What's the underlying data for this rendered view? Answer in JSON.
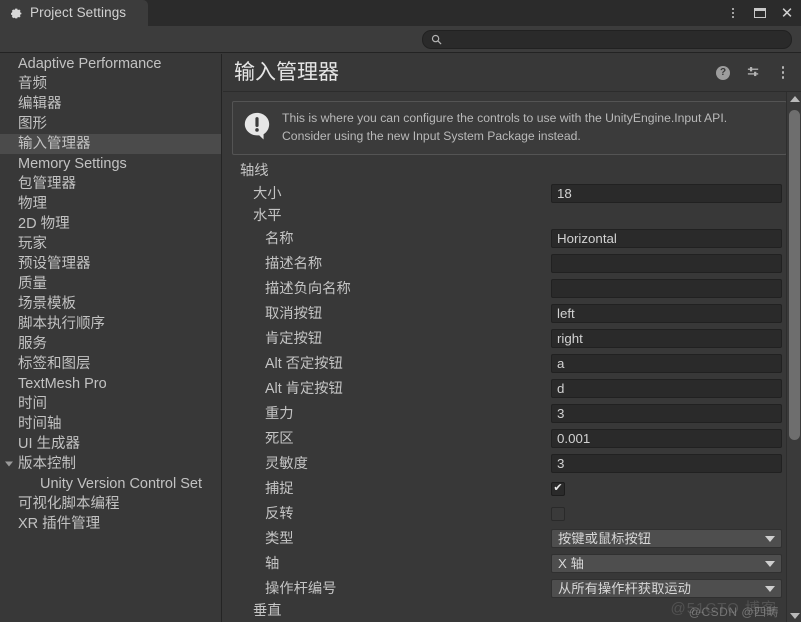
{
  "window": {
    "tab_label": "Project Settings",
    "tab_icon": "gear-icon",
    "controls": {
      "menu": "⋮",
      "maximize": "maximize-icon",
      "close": "✕"
    }
  },
  "search": {
    "value": "",
    "placeholder": "",
    "icon": "search-icon"
  },
  "sidebar": {
    "items": [
      {
        "label": "Adaptive Performance",
        "indent": 0,
        "selected": false,
        "arrow": ""
      },
      {
        "label": "音频",
        "indent": 0,
        "selected": false,
        "arrow": ""
      },
      {
        "label": "编辑器",
        "indent": 0,
        "selected": false,
        "arrow": ""
      },
      {
        "label": "图形",
        "indent": 0,
        "selected": false,
        "arrow": ""
      },
      {
        "label": "输入管理器",
        "indent": 0,
        "selected": true,
        "arrow": ""
      },
      {
        "label": "Memory Settings",
        "indent": 0,
        "selected": false,
        "arrow": ""
      },
      {
        "label": "包管理器",
        "indent": 0,
        "selected": false,
        "arrow": ""
      },
      {
        "label": "物理",
        "indent": 0,
        "selected": false,
        "arrow": ""
      },
      {
        "label": "2D 物理",
        "indent": 0,
        "selected": false,
        "arrow": ""
      },
      {
        "label": "玩家",
        "indent": 0,
        "selected": false,
        "arrow": ""
      },
      {
        "label": "预设管理器",
        "indent": 0,
        "selected": false,
        "arrow": ""
      },
      {
        "label": "质量",
        "indent": 0,
        "selected": false,
        "arrow": ""
      },
      {
        "label": "场景模板",
        "indent": 0,
        "selected": false,
        "arrow": ""
      },
      {
        "label": "脚本执行顺序",
        "indent": 0,
        "selected": false,
        "arrow": ""
      },
      {
        "label": "服务",
        "indent": 0,
        "selected": false,
        "arrow": ""
      },
      {
        "label": "标签和图层",
        "indent": 0,
        "selected": false,
        "arrow": ""
      },
      {
        "label": "TextMesh Pro",
        "indent": 0,
        "selected": false,
        "arrow": ""
      },
      {
        "label": "时间",
        "indent": 0,
        "selected": false,
        "arrow": ""
      },
      {
        "label": "时间轴",
        "indent": 0,
        "selected": false,
        "arrow": ""
      },
      {
        "label": "UI 生成器",
        "indent": 0,
        "selected": false,
        "arrow": ""
      },
      {
        "label": "版本控制",
        "indent": 0,
        "selected": false,
        "arrow": "open"
      },
      {
        "label": "Unity Version Control Set",
        "indent": 1,
        "selected": false,
        "arrow": ""
      },
      {
        "label": "可视化脚本编程",
        "indent": 0,
        "selected": false,
        "arrow": ""
      },
      {
        "label": "XR 插件管理",
        "indent": 0,
        "selected": false,
        "arrow": ""
      }
    ]
  },
  "main": {
    "title": "输入管理器",
    "header_icons": [
      "help-icon",
      "preset-icon",
      "kebab-menu-icon"
    ],
    "info": {
      "icon": "warning-icon",
      "text": "This is where you can configure the controls to use with the UnityEngine.Input API. Consider using the new Input System Package instead."
    },
    "rows": [
      {
        "label": "轴线",
        "indent": 0,
        "arrow": "open",
        "control": "none"
      },
      {
        "label": "大小",
        "indent": 1,
        "arrow": "",
        "control": "text",
        "value": "18"
      },
      {
        "label": "水平",
        "indent": 1,
        "arrow": "open",
        "control": "none"
      },
      {
        "label": "名称",
        "indent": 2,
        "arrow": "",
        "control": "text",
        "value": "Horizontal"
      },
      {
        "label": "描述名称",
        "indent": 2,
        "arrow": "",
        "control": "text",
        "value": ""
      },
      {
        "label": "描述负向名称",
        "indent": 2,
        "arrow": "",
        "control": "text",
        "value": ""
      },
      {
        "label": "取消按钮",
        "indent": 2,
        "arrow": "",
        "control": "text",
        "value": "left"
      },
      {
        "label": "肯定按钮",
        "indent": 2,
        "arrow": "",
        "control": "text",
        "value": "right"
      },
      {
        "label": "Alt 否定按钮",
        "indent": 2,
        "arrow": "",
        "control": "text",
        "value": "a"
      },
      {
        "label": "Alt 肯定按钮",
        "indent": 2,
        "arrow": "",
        "control": "text",
        "value": "d"
      },
      {
        "label": "重力",
        "indent": 2,
        "arrow": "",
        "control": "text",
        "value": "3"
      },
      {
        "label": "死区",
        "indent": 2,
        "arrow": "",
        "control": "text",
        "value": "0.001"
      },
      {
        "label": "灵敏度",
        "indent": 2,
        "arrow": "",
        "control": "text",
        "value": "3"
      },
      {
        "label": "捕捉",
        "indent": 2,
        "arrow": "",
        "control": "checkbox",
        "checked": true
      },
      {
        "label": "反转",
        "indent": 2,
        "arrow": "",
        "control": "checkbox",
        "checked": false
      },
      {
        "label": "类型",
        "indent": 2,
        "arrow": "",
        "control": "dropdown",
        "value": "按键或鼠标按钮"
      },
      {
        "label": "轴",
        "indent": 2,
        "arrow": "",
        "control": "dropdown",
        "value": "X 轴"
      },
      {
        "label": "操作杆编号",
        "indent": 2,
        "arrow": "",
        "control": "dropdown",
        "value": "从所有操作杆获取运动"
      },
      {
        "label": "垂直",
        "indent": 1,
        "arrow": "closed",
        "control": "none"
      }
    ]
  },
  "scrollbar": {
    "up_arrow": "scroll-up-icon",
    "down_arrow": "scroll-down-icon"
  },
  "watermark": {
    "front": "@CSDN @四畴",
    "back": "@51CTO 博客"
  }
}
